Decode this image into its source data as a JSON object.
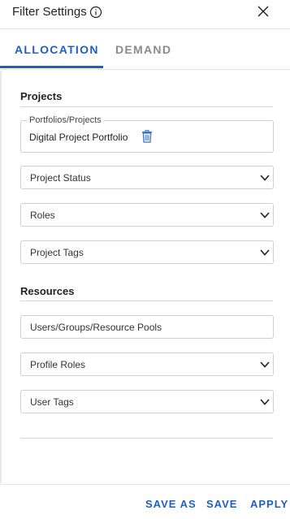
{
  "header": {
    "title": "Filter Settings",
    "info_icon": "info-circle-icon",
    "close_icon": "close-x-icon"
  },
  "tabs": [
    {
      "label": "ALLOCATION",
      "active": true
    },
    {
      "label": "DEMAND",
      "active": false
    }
  ],
  "projects": {
    "title": "Projects",
    "portfolios_legend": "Portfolios/Projects",
    "portfolio_selected": "Digital Project Portfolio",
    "project_status_label": "Project Status",
    "roles_label": "Roles",
    "project_tags_label": "Project Tags"
  },
  "resources": {
    "title": "Resources",
    "users_groups_label": "Users/Groups/Resource Pools",
    "profile_roles_label": "Profile Roles",
    "user_tags_label": "User Tags"
  },
  "footer": {
    "save_as_label": "SAVE AS",
    "save_label": "SAVE",
    "apply_label": "APPLY"
  },
  "colors": {
    "accent": "#1f5fbf",
    "tab_inactive": "#8a8a8a",
    "border": "#cfcfcf",
    "trash_icon": "#3a6fb8"
  }
}
